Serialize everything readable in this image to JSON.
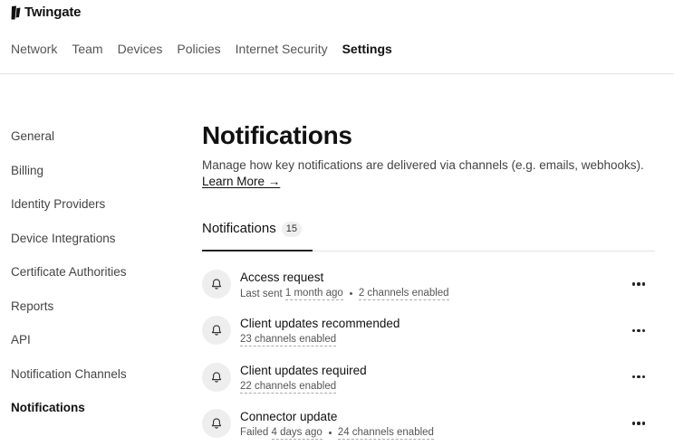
{
  "brand": {
    "name": "Twingate"
  },
  "topnav": [
    {
      "label": "Network"
    },
    {
      "label": "Team"
    },
    {
      "label": "Devices"
    },
    {
      "label": "Policies"
    },
    {
      "label": "Internet Security"
    },
    {
      "label": "Settings",
      "active": true
    }
  ],
  "sidebar": [
    {
      "label": "General"
    },
    {
      "label": "Billing"
    },
    {
      "label": "Identity Providers"
    },
    {
      "label": "Device Integrations"
    },
    {
      "label": "Certificate Authorities"
    },
    {
      "label": "Reports"
    },
    {
      "label": "API"
    },
    {
      "label": "Notification Channels"
    },
    {
      "label": "Notifications",
      "active": true
    }
  ],
  "main": {
    "title": "Notifications",
    "description": "Manage how key notifications are delivered via channels (e.g. emails, webhooks).",
    "learn_more": "Learn More →",
    "tab": {
      "label": "Notifications",
      "count": "15"
    }
  },
  "notifications": [
    {
      "title": "Access request",
      "prefix": "Last sent ",
      "time": "1 month ago",
      "channels": "2 channels enabled"
    },
    {
      "title": "Client updates recommended",
      "channels": "23 channels enabled"
    },
    {
      "title": "Client updates required",
      "channels": "22 channels enabled"
    },
    {
      "title": "Connector update",
      "prefix": "Failed ",
      "time": "4 days ago",
      "channels": "24 channels enabled"
    }
  ],
  "icons": {
    "logo": "twingate-logo-icon",
    "bell": "bell-icon",
    "more": "more-horizontal-icon"
  }
}
